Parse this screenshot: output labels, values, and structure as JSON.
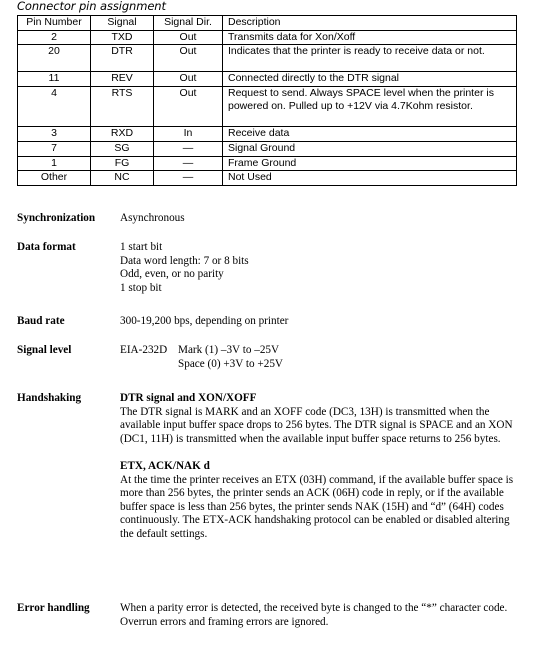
{
  "document": {
    "title": "Connector pin assignment"
  },
  "table": {
    "headers": [
      "Pin Number",
      "Signal",
      "Signal Dir.",
      "Description"
    ],
    "rows": [
      {
        "pin": "2",
        "signal": "TXD",
        "dir": "Out",
        "description": "Transmits data for Xon/Xoff",
        "lines": 1
      },
      {
        "pin": "20",
        "signal": "DTR",
        "dir": "Out",
        "description": "Indicates that the printer is ready to receive data or not.",
        "lines": 2
      },
      {
        "pin": "11",
        "signal": "REV",
        "dir": "Out",
        "description": "Connected directly to the DTR signal",
        "lines": 1
      },
      {
        "pin": "4",
        "signal": "RTS",
        "dir": "Out",
        "description": "Request to send. Always SPACE level when the printer is powered on. Pulled up to +12V via 4.7Kohm resistor.",
        "lines": 3
      },
      {
        "pin": "3",
        "signal": "RXD",
        "dir": "In",
        "description": "Receive data",
        "lines": 1
      },
      {
        "pin": "7",
        "signal": "SG",
        "dir": "—",
        "description": "Signal Ground",
        "lines": 1
      },
      {
        "pin": "1",
        "signal": "FG",
        "dir": "—",
        "description": "Frame Ground",
        "lines": 1
      },
      {
        "pin": "Other",
        "signal": "NC",
        "dir": "—",
        "description": "Not Used",
        "lines": 1
      }
    ]
  },
  "specs": {
    "synchronization": {
      "label": "Synchronization",
      "value": "Asynchronous"
    },
    "data_format": {
      "label": "Data format",
      "line1": "1 start bit",
      "line2": "Data word length: 7 or 8 bits",
      "line3": "Odd, even, or no parity",
      "line4": "1 stop bit"
    },
    "baud_rate": {
      "label": "Baud rate",
      "value": "300-19,200 bps, depending on printer"
    },
    "signal_level": {
      "label": "Signal level",
      "standard": "EIA-232D",
      "mark": "Mark (1) –3V to –25V",
      "space": "Space (0) +3V to +25V"
    },
    "handshaking": {
      "label": "Handshaking",
      "section1_heading": "DTR signal and XON/XOFF",
      "section1_body": "The DTR signal is MARK and an XOFF code (DC3, 13H) is transmitted when the available input buffer space drops to 256 bytes. The DTR signal is SPACE and an XON (DC1, 11H) is transmitted when the available input buffer space returns to 256 bytes.",
      "section2_heading": "ETX, ACK/NAK d",
      "section2_body": "At the time the printer receives an ETX (03H) command, if the available buffer space is more than 256 bytes, the printer sends an ACK (06H) code in reply, or if the available buffer space is less than 256 bytes, the printer sends NAK (15H) and “d” (64H) codes continuously. The ETX-ACK handshaking protocol can be enabled or disabled altering the default settings."
    },
    "error_handling": {
      "label": "Error handling",
      "value": "When a parity error is detected, the received byte is changed to the “*” character code. Overrun errors and framing errors are ignored."
    }
  },
  "colors": {
    "text": "#000000",
    "background": "#ffffff",
    "table_border": "#000000"
  }
}
